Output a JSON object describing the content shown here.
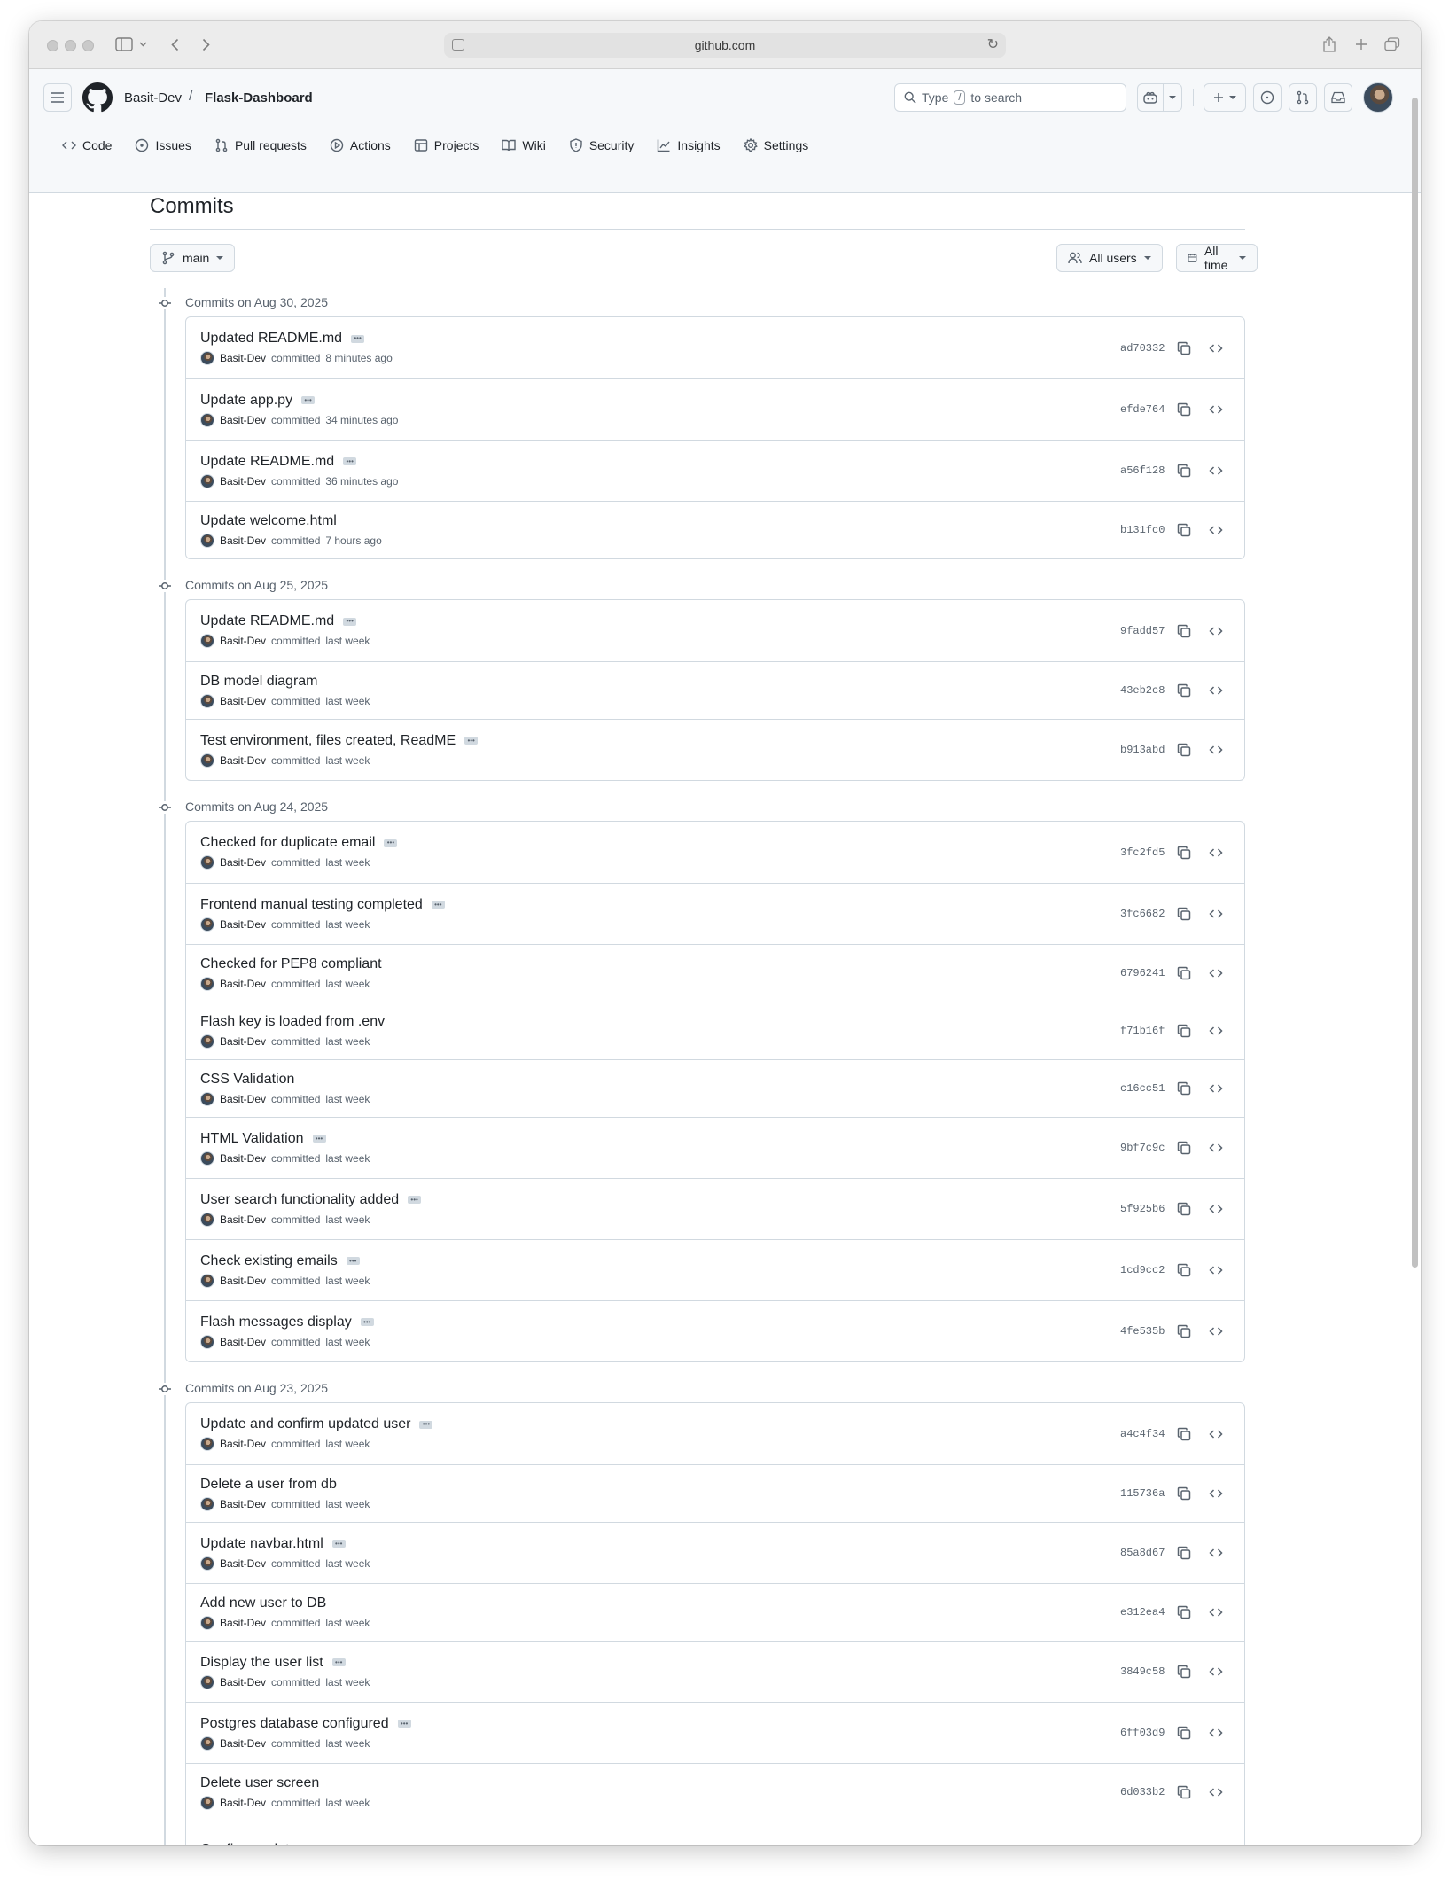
{
  "browser": {
    "url": "github.com"
  },
  "header": {
    "owner": "Basit-Dev",
    "separator": "/",
    "repo": "Flask-Dashboard",
    "search_prefix": "Type",
    "search_key": "/",
    "search_suffix": "to search"
  },
  "repo_nav": [
    {
      "label": "Code",
      "icon": "code-icon"
    },
    {
      "label": "Issues",
      "icon": "issue-icon"
    },
    {
      "label": "Pull requests",
      "icon": "pull-request-icon"
    },
    {
      "label": "Actions",
      "icon": "play-icon"
    },
    {
      "label": "Projects",
      "icon": "table-icon"
    },
    {
      "label": "Wiki",
      "icon": "book-icon"
    },
    {
      "label": "Security",
      "icon": "shield-icon"
    },
    {
      "label": "Insights",
      "icon": "graph-icon"
    },
    {
      "label": "Settings",
      "icon": "gear-icon"
    }
  ],
  "page": {
    "title": "Commits",
    "branch": "main",
    "users_filter": "All users",
    "time_filter": "All time"
  },
  "groups": [
    {
      "heading": "Commits on Aug 30, 2025",
      "commits": [
        {
          "title": "Updated README.md",
          "has_body": true,
          "author": "Basit-Dev",
          "verb": "committed",
          "when": "8 minutes ago",
          "sha": "ad70332"
        },
        {
          "title": "Update app.py",
          "has_body": true,
          "author": "Basit-Dev",
          "verb": "committed",
          "when": "34 minutes ago",
          "sha": "efde764"
        },
        {
          "title": "Update README.md",
          "has_body": true,
          "author": "Basit-Dev",
          "verb": "committed",
          "when": "36 minutes ago",
          "sha": "a56f128"
        },
        {
          "title": "Update welcome.html",
          "has_body": false,
          "author": "Basit-Dev",
          "verb": "committed",
          "when": "7 hours ago",
          "sha": "b131fc0"
        }
      ]
    },
    {
      "heading": "Commits on Aug 25, 2025",
      "commits": [
        {
          "title": "Update README.md",
          "has_body": true,
          "author": "Basit-Dev",
          "verb": "committed",
          "when": "last week",
          "sha": "9fadd57"
        },
        {
          "title": "DB model diagram",
          "has_body": false,
          "author": "Basit-Dev",
          "verb": "committed",
          "when": "last week",
          "sha": "43eb2c8"
        },
        {
          "title": "Test environment, files created, ReadME",
          "has_body": true,
          "author": "Basit-Dev",
          "verb": "committed",
          "when": "last week",
          "sha": "b913abd"
        }
      ]
    },
    {
      "heading": "Commits on Aug 24, 2025",
      "commits": [
        {
          "title": "Checked for duplicate email",
          "has_body": true,
          "author": "Basit-Dev",
          "verb": "committed",
          "when": "last week",
          "sha": "3fc2fd5"
        },
        {
          "title": "Frontend manual testing completed",
          "has_body": true,
          "author": "Basit-Dev",
          "verb": "committed",
          "when": "last week",
          "sha": "3fc6682"
        },
        {
          "title": "Checked for PEP8 compliant",
          "has_body": false,
          "author": "Basit-Dev",
          "verb": "committed",
          "when": "last week",
          "sha": "6796241"
        },
        {
          "title": "Flash key is loaded from .env",
          "has_body": false,
          "author": "Basit-Dev",
          "verb": "committed",
          "when": "last week",
          "sha": "f71b16f"
        },
        {
          "title": "CSS Validation",
          "has_body": false,
          "author": "Basit-Dev",
          "verb": "committed",
          "when": "last week",
          "sha": "c16cc51"
        },
        {
          "title": "HTML Validation",
          "has_body": true,
          "author": "Basit-Dev",
          "verb": "committed",
          "when": "last week",
          "sha": "9bf7c9c"
        },
        {
          "title": "User search functionality added",
          "has_body": true,
          "author": "Basit-Dev",
          "verb": "committed",
          "when": "last week",
          "sha": "5f925b6"
        },
        {
          "title": "Check existing emails",
          "has_body": true,
          "author": "Basit-Dev",
          "verb": "committed",
          "when": "last week",
          "sha": "1cd9cc2"
        },
        {
          "title": "Flash messages display",
          "has_body": true,
          "author": "Basit-Dev",
          "verb": "committed",
          "when": "last week",
          "sha": "4fe535b"
        }
      ]
    },
    {
      "heading": "Commits on Aug 23, 2025",
      "commits": [
        {
          "title": "Update and confirm updated user",
          "has_body": true,
          "author": "Basit-Dev",
          "verb": "committed",
          "when": "last week",
          "sha": "a4c4f34"
        },
        {
          "title": "Delete a user from db",
          "has_body": false,
          "author": "Basit-Dev",
          "verb": "committed",
          "when": "last week",
          "sha": "115736a"
        },
        {
          "title": "Update navbar.html",
          "has_body": true,
          "author": "Basit-Dev",
          "verb": "committed",
          "when": "last week",
          "sha": "85a8d67"
        },
        {
          "title": "Add new user to DB",
          "has_body": false,
          "author": "Basit-Dev",
          "verb": "committed",
          "when": "last week",
          "sha": "e312ea4"
        },
        {
          "title": "Display the user list",
          "has_body": true,
          "author": "Basit-Dev",
          "verb": "committed",
          "when": "last week",
          "sha": "3849c58"
        },
        {
          "title": "Postgres database configured",
          "has_body": true,
          "author": "Basit-Dev",
          "verb": "committed",
          "when": "last week",
          "sha": "6ff03d9"
        },
        {
          "title": "Delete user screen",
          "has_body": false,
          "author": "Basit-Dev",
          "verb": "committed",
          "when": "last week",
          "sha": "6d033b2"
        },
        {
          "title": "Confirm update screen",
          "has_body": false,
          "author": "",
          "verb": "",
          "when": "",
          "sha": ""
        }
      ]
    }
  ]
}
